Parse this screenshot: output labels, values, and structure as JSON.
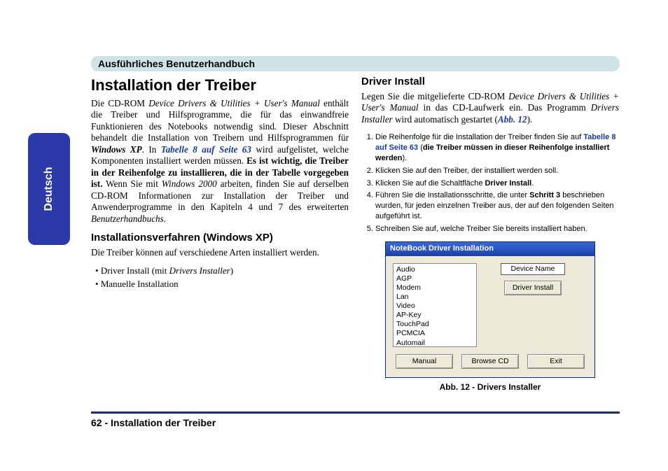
{
  "header": {
    "banner": "Ausführliches Benutzerhandbuch"
  },
  "sideTab": {
    "label": "Deutsch"
  },
  "left": {
    "h1": "Installation der Treiber",
    "p1_a": "Die CD-ROM ",
    "p1_cd": "Device Drivers & Utilities + User's Manual",
    "p1_b": " enthält die Treiber und Hilfsprogramme, die für das einwandfreie Funktionieren des Notebooks notwendig sind. Dieser Abschnitt behandelt die Installation von Treibern und Hilfsprogrammen für ",
    "p1_os": "Windows XP",
    "p1_c": ". In ",
    "p1_link": "Tabelle 8 auf Seite 63",
    "p1_d": " wird aufgelistet, welche Komponenten installiert werden müssen. ",
    "p1_bold": "Es ist wichtig, die Treiber in der Reihenfolge zu installieren, die in der Tabelle vorgegeben ist.",
    "p1_e": " Wenn Sie mit ",
    "p1_os2": "Windows 2000",
    "p1_f": " arbeiten, finden Sie auf derselben CD-ROM Informationen zur Installation der Treiber und Anwenderprogramme in den Kapiteln 4 und 7 des erweiterten ",
    "p1_manual": "Benutzerhandbuchs",
    "p1_g": ".",
    "h2": "Installationsverfahren (Windows XP)",
    "p2": "Die Treiber können auf verschiedene Arten installiert werden.",
    "bullet1_a": "Driver Install (mit ",
    "bullet1_i": "Drivers Installer",
    "bullet1_b": ")",
    "bullet2": "Manuelle Installation"
  },
  "right": {
    "h2": "Driver Install",
    "p1_a": "Legen Sie die mitgelieferte CD-ROM ",
    "p1_cd": "Device Drivers & Utilities + User's Manual",
    "p1_b": " in das CD-Laufwerk ein. Das Programm ",
    "p1_prog": "Drivers Installer",
    "p1_c": " wird automatisch gestartet (",
    "p1_link": "Abb. 12",
    "p1_d": ").",
    "steps": {
      "s1_a": "Die Reihenfolge für die Installation der Treiber finden Sie auf ",
      "s1_link": "Tabelle 8 auf Seite 63",
      "s1_b": " (",
      "s1_bold": "die Treiber müssen in dieser Reihenfolge installiert werden",
      "s1_c": ").",
      "s2": "Klicken Sie auf den Treiber, der installiert werden soll.",
      "s3_a": "Klicken Sie auf die Schaltfläche ",
      "s3_bold": "Driver Install",
      "s3_b": ".",
      "s4_a": "Führen Sie die Installationsschritte, die unter ",
      "s4_bold": "Schritt 3",
      "s4_b": " beschrieben wurden, für jeden einzelnen Treiber aus, der auf den folgenden Seiten aufgeführt ist.",
      "s5": "Schreiben Sie auf, welche Treiber Sie bereits installiert haben."
    }
  },
  "figure": {
    "winTitle": "NoteBook Driver Installation",
    "drivers": [
      "Audio",
      "AGP",
      "Modem",
      "Lan",
      "Video",
      "AP-Key",
      "TouchPad",
      "PCMCIA",
      "Automail"
    ],
    "deviceName": "Device Name",
    "btnDriverInstall": "Driver Install",
    "btnManual": "Manual",
    "btnBrowse": "Browse CD",
    "btnExit": "Exit",
    "caption": "Abb. 12 - Drivers Installer"
  },
  "footer": {
    "text": "62 -  Installation der Treiber"
  }
}
